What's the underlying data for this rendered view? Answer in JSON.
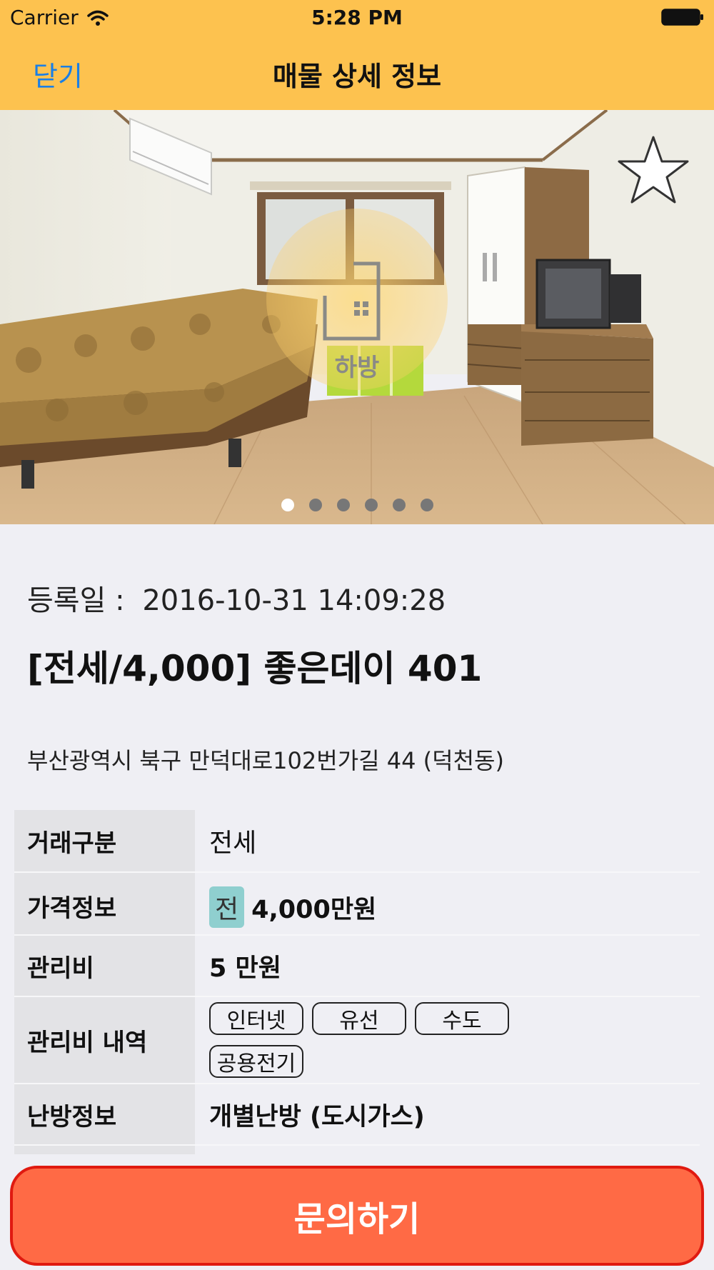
{
  "status": {
    "carrier": "Carrier",
    "time": "5:28 PM"
  },
  "nav": {
    "close_label": "닫기",
    "title": "매물 상세 정보"
  },
  "photo": {
    "page_count": 6,
    "active_page": 1
  },
  "listing": {
    "registered_label": "등록일 :",
    "registered_value": "2016-10-31 14:09:28",
    "title": "[전세/4,000] 좋은데이 401",
    "address": "부산광역시 북구 만덕대로102번가길 44 (덕천동)"
  },
  "details": {
    "deal_type": {
      "label": "거래구분",
      "value": "전세"
    },
    "price": {
      "label": "가격정보",
      "badge": "전",
      "value": "4,000만원"
    },
    "maintenance": {
      "label": "관리비",
      "value": "5 만원"
    },
    "maintenance_items": {
      "label": "관리비 내역",
      "tags": [
        "인터넷",
        "유선",
        "수도",
        "공용전기"
      ]
    },
    "heating": {
      "label": "난방정보",
      "value": "개별난방 (도시가스)"
    }
  },
  "actions": {
    "inquiry_label": "문의하기"
  },
  "colors": {
    "nav_bg": "#fdc24f",
    "close_link": "#1a7fe6",
    "inquiry_bg": "#ff6a45",
    "inquiry_border": "#e01a10",
    "price_badge": "#8fcfcf"
  }
}
